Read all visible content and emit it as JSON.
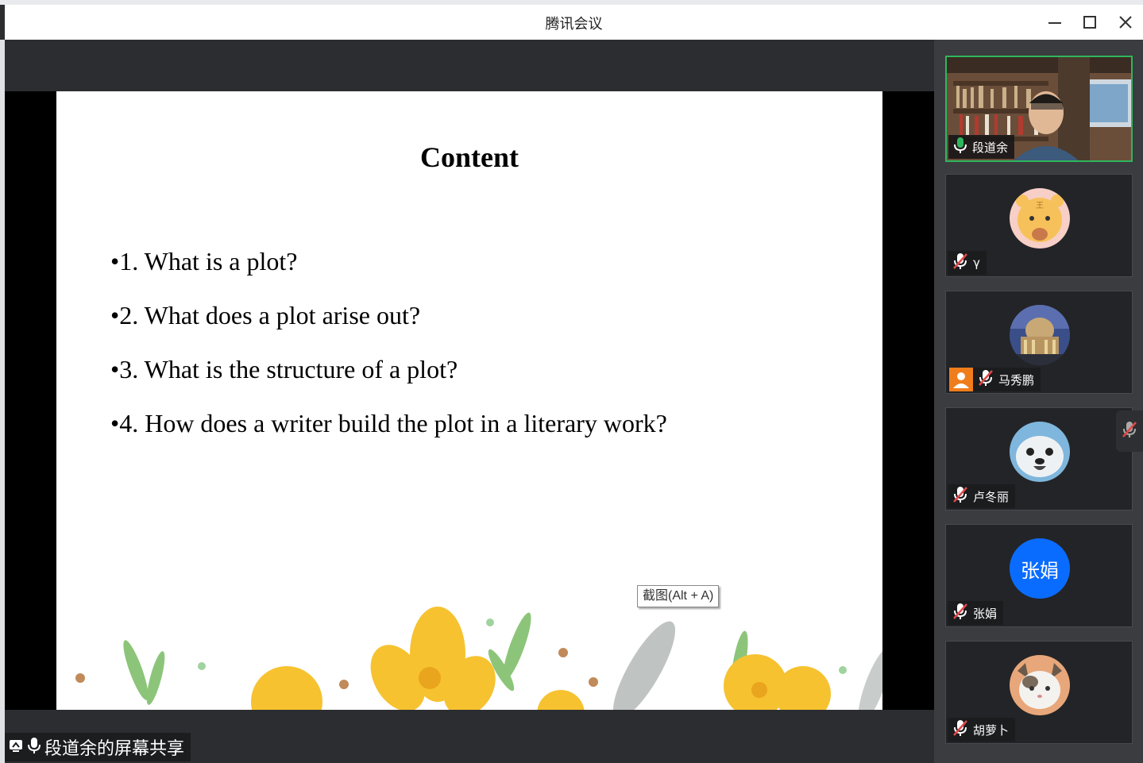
{
  "window": {
    "title": "腾讯会议",
    "controls": [
      "minimize-icon",
      "maximize-icon",
      "close-icon"
    ]
  },
  "slide": {
    "title": "Content",
    "bullets": [
      "•1. What is a plot?",
      "•2. What does a plot arise out?",
      "•3. What is the structure of a plot?",
      "•4. How does a writer build the plot in a literary work?"
    ]
  },
  "tooltip": {
    "text": "截图(Alt + A)"
  },
  "share_badge": {
    "label": "段道余的屏幕共享",
    "icons": [
      "screen-share-icon",
      "mic-icon"
    ]
  },
  "participants": [
    {
      "name": "段道余",
      "mic": "on",
      "video": true
    },
    {
      "name": "γ",
      "mic": "muted",
      "avatar": "tiger-cartoon"
    },
    {
      "name": "马秀鹏",
      "mic": "muted",
      "avatar": "building-photo",
      "host_badge": true
    },
    {
      "name": "卢冬丽",
      "mic": "muted",
      "avatar": "seal-photo"
    },
    {
      "name": "张娟",
      "mic": "muted",
      "avatar_text": "张娟"
    },
    {
      "name": "胡萝卜",
      "mic": "muted",
      "avatar": "cat-photo"
    }
  ],
  "colors": {
    "active_speaker_border": "#2fb65d",
    "mic_on": "#2fb65d",
    "mic_muted": "#e04848",
    "avatar_blue": "#0a6cff",
    "host_badge": "#f07d1b"
  }
}
